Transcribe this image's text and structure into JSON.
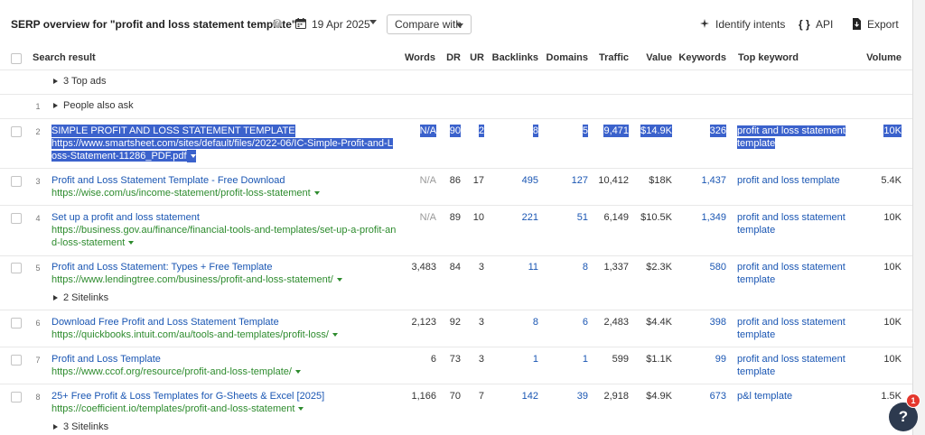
{
  "header": {
    "title": "SERP overview for \"profit and loss statement template\"",
    "date": "19 Apr 2025",
    "compare_label": "Compare with",
    "identify_intents": "Identify intents",
    "api": "API",
    "export": "Export"
  },
  "columns": {
    "search_result": "Search result",
    "words": "Words",
    "dr": "DR",
    "ur": "UR",
    "backlinks": "Backlinks",
    "domains": "Domains",
    "traffic": "Traffic",
    "value": "Value",
    "keywords": "Keywords",
    "top_keyword": "Top keyword",
    "volume": "Volume"
  },
  "special_rows": {
    "top_ads": "3 Top ads",
    "people_also_ask_num": "1",
    "people_also_ask": "People also ask"
  },
  "rows": [
    {
      "num": "2",
      "title": "SIMPLE PROFIT AND LOSS STATEMENT TEMPLATE",
      "url": "https://www.smartsheet.com/sites/default/files/2022-06/IC-Simple-Profit-and-Loss-Statement-11286_PDF.pdf",
      "words": "N/A",
      "dr": "90",
      "ur": "2",
      "backlinks": "8",
      "domains": "5",
      "traffic": "9,471",
      "value": "$14.9K",
      "keywords": "326",
      "top_keyword": "profit and loss statement template",
      "volume": "10K",
      "selected": true
    },
    {
      "num": "3",
      "title": "Profit and Loss Statement Template - Free Download",
      "url": "https://wise.com/us/income-statement/profit-loss-statement",
      "words": "N/A",
      "dr": "86",
      "ur": "17",
      "backlinks": "495",
      "domains": "127",
      "traffic": "10,412",
      "value": "$18K",
      "keywords": "1,437",
      "top_keyword": "profit and loss template",
      "volume": "5.4K"
    },
    {
      "num": "4",
      "title": "Set up a profit and loss statement",
      "url": "https://business.gov.au/finance/financial-tools-and-templates/set-up-a-profit-and-loss-statement",
      "words": "N/A",
      "dr": "89",
      "ur": "10",
      "backlinks": "221",
      "domains": "51",
      "traffic": "6,149",
      "value": "$10.5K",
      "keywords": "1,349",
      "top_keyword": "profit and loss statement template",
      "volume": "10K"
    },
    {
      "num": "5",
      "title": "Profit and Loss Statement: Types + Free Template",
      "url": "https://www.lendingtree.com/business/profit-and-loss-statement/",
      "words": "3,483",
      "dr": "84",
      "ur": "3",
      "backlinks": "11",
      "domains": "8",
      "traffic": "1,337",
      "value": "$2.3K",
      "keywords": "580",
      "top_keyword": "profit and loss statement template",
      "volume": "10K",
      "sitelinks": "2 Sitelinks"
    },
    {
      "num": "6",
      "title": "Download Free Profit and Loss Statement Template",
      "url": "https://quickbooks.intuit.com/au/tools-and-templates/profit-loss/",
      "words": "2,123",
      "dr": "92",
      "ur": "3",
      "backlinks": "8",
      "domains": "6",
      "traffic": "2,483",
      "value": "$4.4K",
      "keywords": "398",
      "top_keyword": "profit and loss statement template",
      "volume": "10K"
    },
    {
      "num": "7",
      "title": "Profit and Loss Template",
      "url": "https://www.ccof.org/resource/profit-and-loss-template/",
      "words": "6",
      "dr": "73",
      "ur": "3",
      "backlinks": "1",
      "domains": "1",
      "traffic": "599",
      "value": "$1.1K",
      "keywords": "99",
      "top_keyword": "profit and loss statement template",
      "volume": "10K"
    },
    {
      "num": "8",
      "title": "25+ Free Profit & Loss Templates for G-Sheets & Excel [2025]",
      "url": "https://coefficient.io/templates/profit-and-loss-statement",
      "words": "1,166",
      "dr": "70",
      "ur": "7",
      "backlinks": "142",
      "domains": "39",
      "traffic": "2,918",
      "value": "$4.9K",
      "keywords": "673",
      "top_keyword": "p&l template",
      "volume": "1.5K",
      "sitelinks": "3 Sitelinks"
    }
  ],
  "help_fab": {
    "label": "?",
    "badge": "1"
  }
}
